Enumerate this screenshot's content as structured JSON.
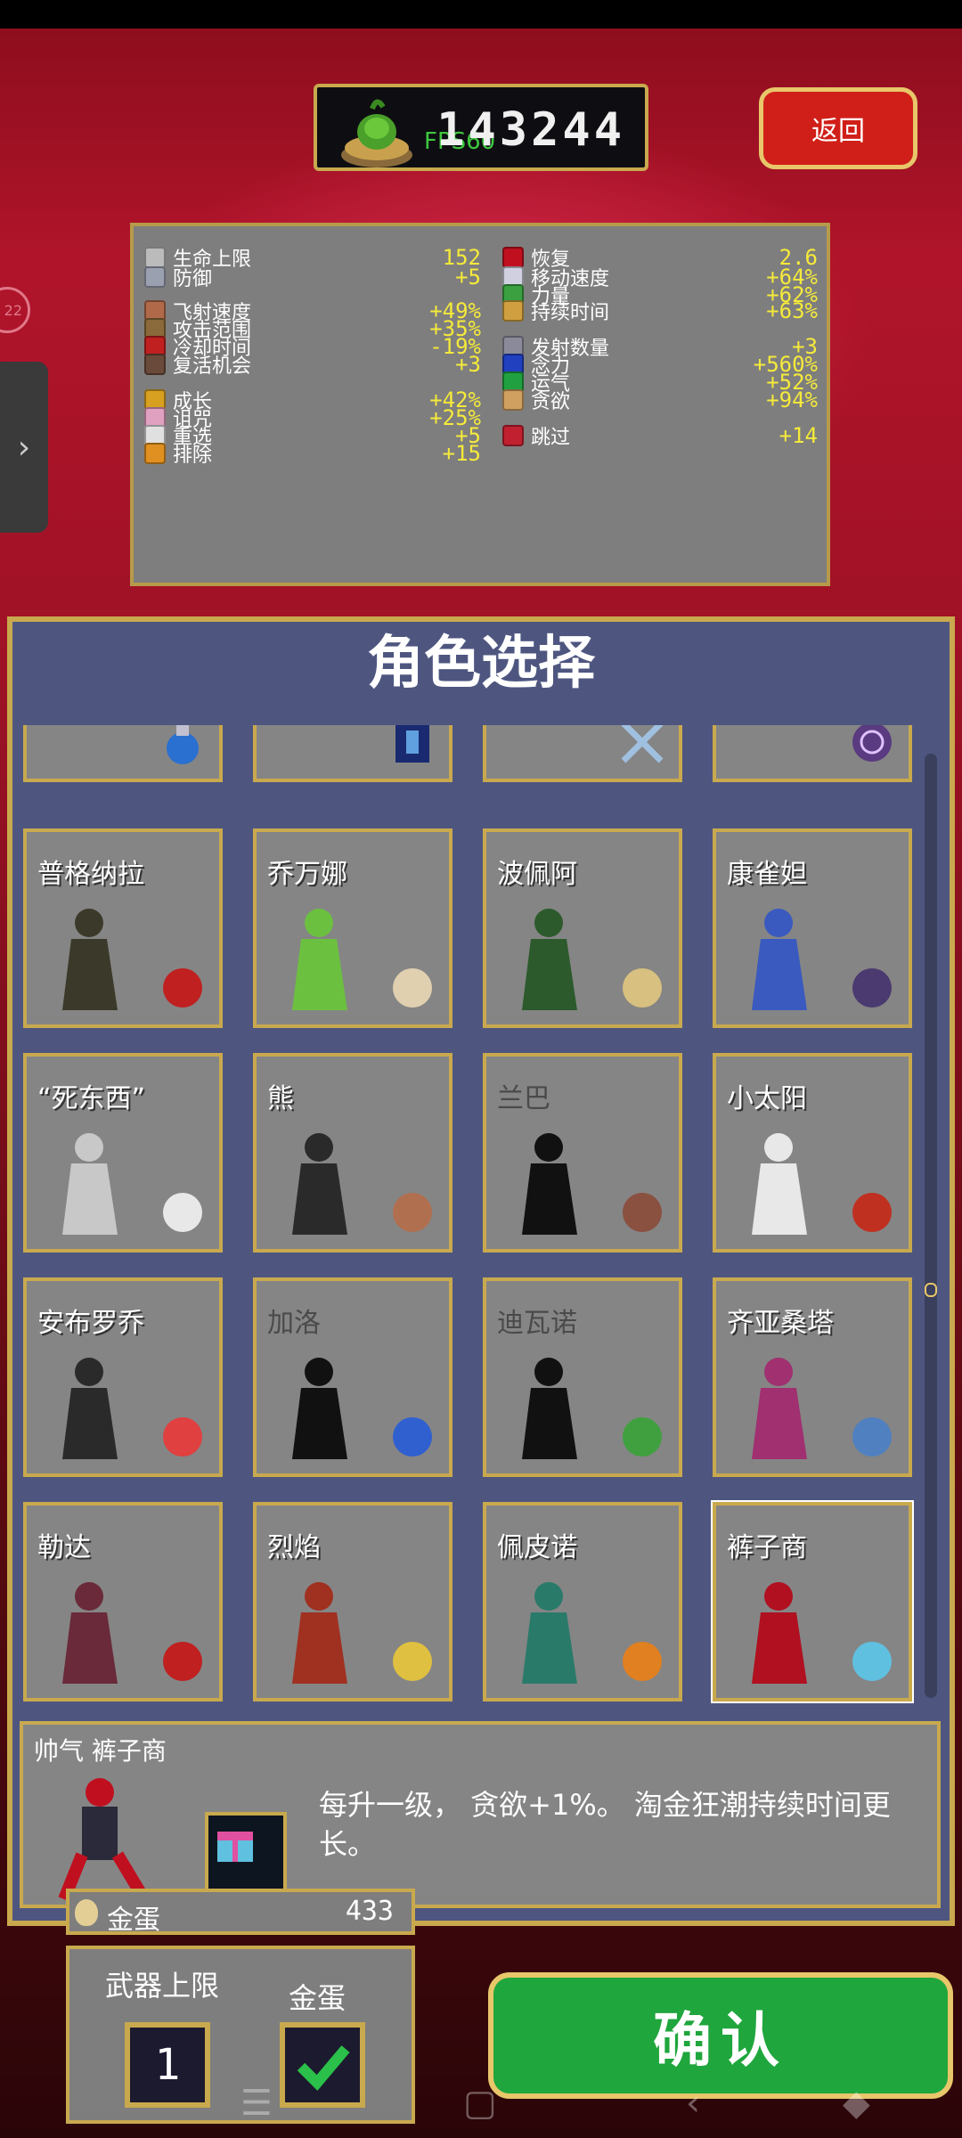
{
  "header": {
    "coins": "143244",
    "fps": "FPS60",
    "back_label": "返回",
    "side_badge": "22"
  },
  "stats": {
    "left": [
      {
        "icon": "heart-icon",
        "color": "#bbbbbb",
        "name": "生命上限",
        "value": "152"
      },
      {
        "icon": "armor-icon",
        "color": "#9aa0b0",
        "name": "防御",
        "value": "+5"
      },
      {
        "icon": "speed-icon",
        "color": "#b06a4a",
        "name": "飞射速度",
        "value": "+49%"
      },
      {
        "icon": "area-icon",
        "color": "#8a6a3a",
        "name": "攻击范围",
        "value": "+35%"
      },
      {
        "icon": "cooldown-icon",
        "color": "#c02020",
        "name": "冷却时间",
        "value": "-19%"
      },
      {
        "icon": "revival-icon",
        "color": "#6a4a3a",
        "name": "复活机会",
        "value": "+3"
      },
      {
        "icon": "crown-icon",
        "color": "#d8a020",
        "name": "成长",
        "value": "+42%"
      },
      {
        "icon": "skull-icon",
        "color": "#e0a0c0",
        "name": "诅咒",
        "value": "+25%"
      },
      {
        "icon": "dice-icon",
        "color": "#e0e0e0",
        "name": "重选",
        "value": "+5"
      },
      {
        "icon": "banish-icon",
        "color": "#e09020",
        "name": "排除",
        "value": "+15"
      }
    ],
    "right": [
      {
        "icon": "heart-red-icon",
        "color": "#c01020",
        "name": "恢复",
        "value": "2.6"
      },
      {
        "icon": "wing-icon",
        "color": "#d0d0e0",
        "name": "移动速度",
        "value": "+64%"
      },
      {
        "icon": "leaf-icon",
        "color": "#3aa040",
        "name": "力量",
        "value": "+62%"
      },
      {
        "icon": "hourglass-icon",
        "color": "#d0a040",
        "name": "持续时间",
        "value": "+63%"
      },
      {
        "icon": "amount-icon",
        "color": "#8a8a9a",
        "name": "发射数量",
        "value": "+3"
      },
      {
        "icon": "orb-icon",
        "color": "#2040c0",
        "name": "念力",
        "value": "+560%"
      },
      {
        "icon": "clover-icon",
        "color": "#20a040",
        "name": "运气",
        "value": "+52%"
      },
      {
        "icon": "greed-icon",
        "color": "#d0a060",
        "name": "贪欲",
        "value": "+94%"
      },
      {
        "icon": "skip-icon",
        "color": "#c02030",
        "name": "跳过",
        "value": "+14"
      }
    ]
  },
  "panel": {
    "title": "角色选择"
  },
  "characters": [
    {
      "name": "普格纳拉",
      "locked": false,
      "fig": "#3b3a2a",
      "item": "#c02020"
    },
    {
      "name": "乔万娜",
      "locked": false,
      "fig": "#6cc040",
      "item": "#e0d0b0"
    },
    {
      "name": "波佩阿",
      "locked": false,
      "fig": "#2c5a2c",
      "item": "#d8c080"
    },
    {
      "name": "康雀妲",
      "locked": false,
      "fig": "#3a5ac0",
      "item": "#4a3a70"
    },
    {
      "name": "“死东西”",
      "locked": false,
      "fig": "#c8c8c8",
      "item": "#e8e8e8"
    },
    {
      "name": "熊",
      "locked": false,
      "fig": "#2a2a2a",
      "item": "#b07050"
    },
    {
      "name": "兰巴",
      "locked": true,
      "fig": "#111111",
      "item": "#8a5040"
    },
    {
      "name": "小太阳",
      "locked": false,
      "fig": "#e8e8e8",
      "item": "#c03020"
    },
    {
      "name": "安布罗乔",
      "locked": false,
      "fig": "#2a2a2a",
      "item": "#e04040"
    },
    {
      "name": "加洛",
      "locked": true,
      "fig": "#111111",
      "item": "#3060d0"
    },
    {
      "name": "迪瓦诺",
      "locked": true,
      "fig": "#111111",
      "item": "#40a040"
    },
    {
      "name": "齐亚桑塔",
      "locked": false,
      "fig": "#a03070",
      "item": "#5080c0"
    },
    {
      "name": "勒达",
      "locked": false,
      "fig": "#6a2a3a",
      "item": "#c02020"
    },
    {
      "name": "烈焰",
      "locked": false,
      "fig": "#a03020",
      "item": "#e0c040"
    },
    {
      "name": "佩皮诺",
      "locked": false,
      "fig": "#2a7a6a",
      "item": "#e08020"
    },
    {
      "name": "裤子商",
      "locked": false,
      "fig": "#b01020",
      "item": "#60c0e0"
    }
  ],
  "description": {
    "title": "帅气 裤子商",
    "text": "每升一级， 贪欲+1%。 淘金狂潮持续时间更长。"
  },
  "footer": {
    "egg_label": "金蛋",
    "egg_count": "433",
    "weapon_limit_label": "武器上限",
    "weapon_limit_value": "1",
    "golden_egg_label": "金蛋",
    "confirm_label": "确认"
  }
}
